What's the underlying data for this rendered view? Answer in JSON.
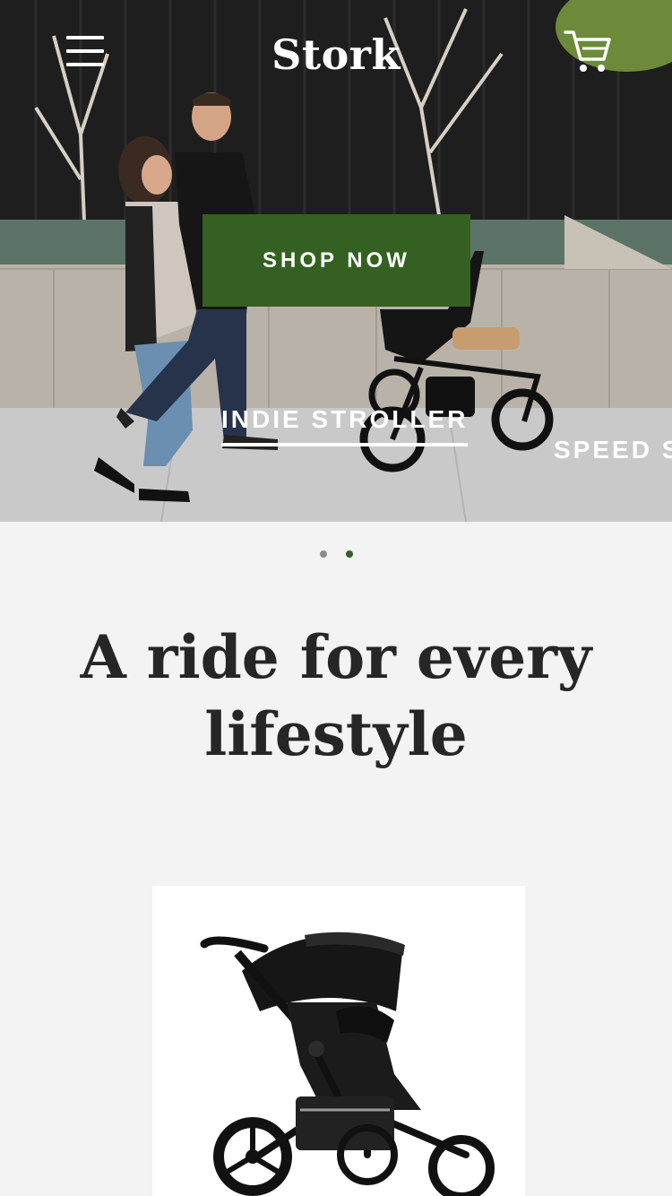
{
  "header": {
    "logo": "Stork",
    "menu_icon": "hamburger-menu-icon",
    "cart_icon": "shopping-cart-icon"
  },
  "hero": {
    "cta_label": "SHOP NOW",
    "slides": [
      {
        "label": "INDIE STROLLER"
      },
      {
        "label": "SPEED ST"
      }
    ],
    "colors": {
      "cta": "#346121"
    }
  },
  "carousel": {
    "dot_count": 2,
    "active_index": 1
  },
  "section": {
    "headline": "A ride for every lifestyle"
  }
}
